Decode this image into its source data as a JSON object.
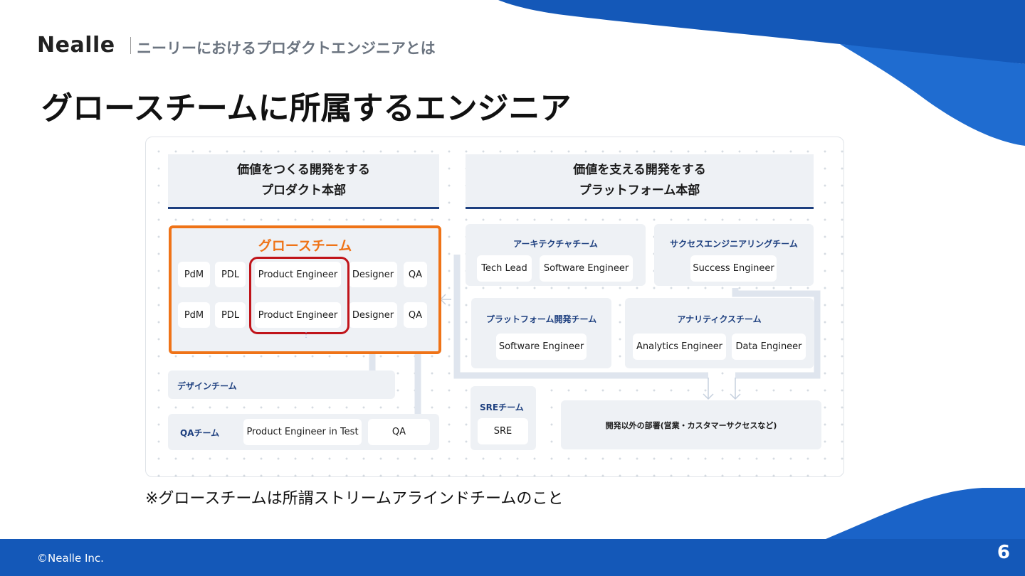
{
  "header": {
    "logo": "Nealle",
    "subtitle": "ニーリーにおけるプロダクトエンジニアとは"
  },
  "title": "グロースチームに所属するエンジニア",
  "diagram": {
    "product_division": {
      "line1": "価値をつくる開発をする",
      "line2": "プロダクト本部"
    },
    "platform_division": {
      "line1": "価値を支える開発をする",
      "line2": "プラットフォーム本部"
    },
    "growth_team": {
      "title": "グロースチーム",
      "rows": [
        [
          "PdM",
          "PDL",
          "Product Engineer",
          "Designer",
          "QA"
        ],
        [
          "PdM",
          "PDL",
          "Product Engineer",
          "Designer",
          "QA"
        ]
      ],
      "more": "⋮"
    },
    "design_team": {
      "title": "デザインチーム"
    },
    "qa_team": {
      "title": "QAチーム",
      "members": [
        "Product Engineer in Test",
        "QA"
      ]
    },
    "architecture_team": {
      "title": "アーキテクチャチーム",
      "members": [
        "Tech Lead",
        "Software Engineer"
      ]
    },
    "success_team": {
      "title": "サクセスエンジニアリングチーム",
      "members": [
        "Success Engineer"
      ]
    },
    "platform_dev_team": {
      "title": "プラットフォーム開発チーム",
      "members": [
        "Software Engineer"
      ]
    },
    "analytics_team": {
      "title": "アナリティクスチーム",
      "members": [
        "Analytics Engineer",
        "Data Engineer"
      ]
    },
    "sre_team": {
      "title": "SREチーム",
      "members": [
        "SRE"
      ]
    },
    "non_dev": {
      "label": "開発以外の部署(営業・カスタマーサクセスなど)"
    }
  },
  "footnote": "※グロースチームは所謂ストリームアラインドチームのこと",
  "footer": {
    "copyright": "©Nealle Inc.",
    "page": "6"
  },
  "colors": {
    "brand_blue": "#1458b8",
    "navy": "#1d3f7f",
    "orange": "#ef7317",
    "red": "#c0141a",
    "panel": "#eef1f5"
  }
}
